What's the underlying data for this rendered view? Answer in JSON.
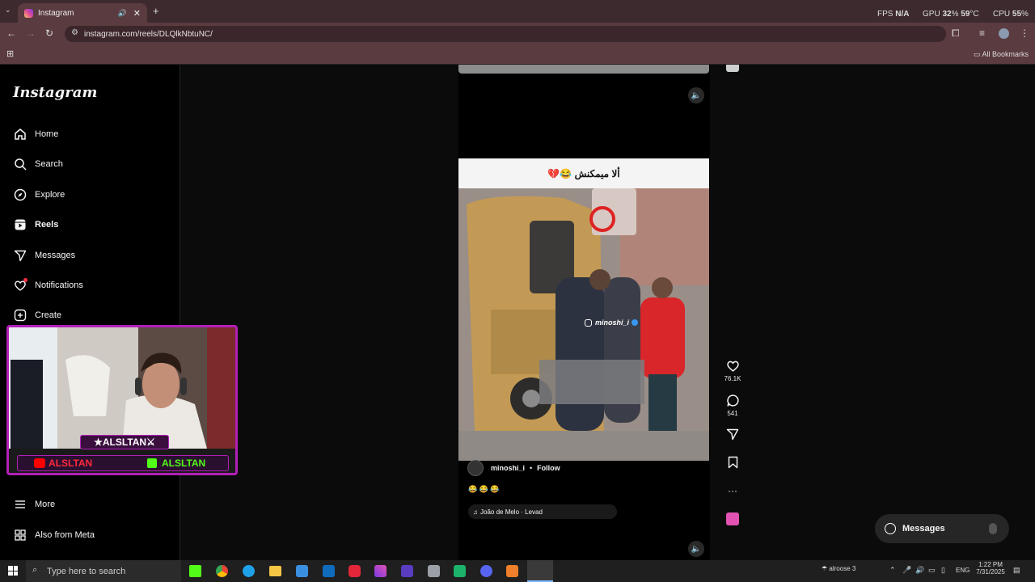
{
  "browser": {
    "tab_title": "Instagram",
    "url": "instagram.com/reels/DLQlkNbtuNC/",
    "all_bookmarks": "All Bookmarks",
    "fps_label": "FPS",
    "fps_value": "N/A",
    "gpu_label": "GPU",
    "gpu_value": "32",
    "gpu_pct": "%",
    "gpu_temp": "59",
    "gpu_unit": "°C",
    "cpu_label": "CPU",
    "cpu_value": "55",
    "cpu_pct": "%"
  },
  "sidebar": {
    "logo": "Instagram",
    "items": [
      {
        "label": "Home",
        "icon": "home-icon"
      },
      {
        "label": "Search",
        "icon": "search-icon"
      },
      {
        "label": "Explore",
        "icon": "compass-icon"
      },
      {
        "label": "Reels",
        "icon": "reels-icon"
      },
      {
        "label": "Messages",
        "icon": "send-icon"
      },
      {
        "label": "Notifications",
        "icon": "heart-icon"
      },
      {
        "label": "Create",
        "icon": "plus-square-icon"
      }
    ],
    "more": "More",
    "also_from_meta": "Also from Meta"
  },
  "reel": {
    "caption_overlay": "ألا ميمكنش 😂💔",
    "watermark": "minoshi_i",
    "likes": "76.1K",
    "comments": "541",
    "username": "minoshi_i",
    "separator": "•",
    "follow": "Follow",
    "caption": "😂 😂 😂",
    "audio": "João de Melo · Levad"
  },
  "webcam": {
    "name_tag": "★ALSLTAN⚔",
    "youtube_handle": "ALSLTAN",
    "kick_handle": "ALSLTAN"
  },
  "messages_bubble": {
    "label": "Messages"
  },
  "taskbar": {
    "search_placeholder": "Type here to search",
    "weather": "alroose 3",
    "lang": "ENG",
    "time": "1:22 PM",
    "date": "7/31/2025"
  },
  "colors": {
    "accent_pink": "#df4996",
    "stream_purple": "#b21fb8",
    "kick_green": "#53fc18"
  }
}
